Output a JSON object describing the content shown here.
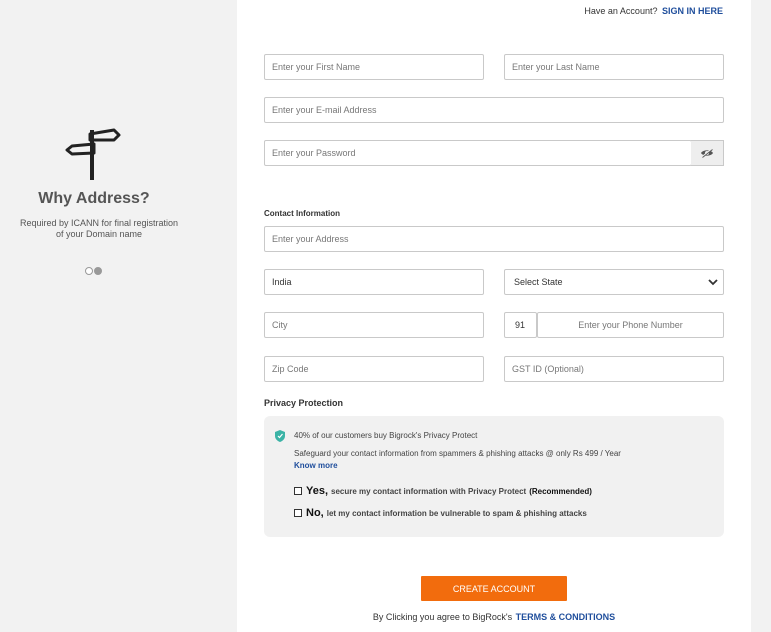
{
  "left_panel": {
    "title": "Why Address?",
    "description_line1": "Required by ICANN for final registration",
    "description_line2": "of your Domain name",
    "icon": "signpost-icon"
  },
  "header": {
    "have_account": "Have an Account?",
    "sign_in": "SIGN IN HERE"
  },
  "form": {
    "first_name_placeholder": "Enter your First Name",
    "last_name_placeholder": "Enter your Last Name",
    "email_placeholder": "Enter your E-mail Address",
    "password_placeholder": "Enter your Password",
    "contact_label": "Contact Information",
    "address_placeholder": "Enter your Address",
    "country_value": "India",
    "state_value": "Select State",
    "city_placeholder": "City",
    "phone_code": "91",
    "phone_placeholder": "Enter your Phone Number",
    "zip_placeholder": "Zip Code",
    "gst_placeholder": "GST ID (Optional)"
  },
  "privacy": {
    "title": "Privacy Protection",
    "stat": "40% of our customers buy Bigrock's Privacy Protect",
    "description": "Safeguard your contact information from spammers & phishing attacks @ only Rs 499 / Year",
    "know_more": "Know more",
    "yes_word": "Yes,",
    "yes_text": "secure my contact information with Privacy Protect",
    "yes_recommended": "(Recommended)",
    "no_word": "No,",
    "no_text": "let my contact information be vulnerable to spam & phishing attacks"
  },
  "footer": {
    "create_button": "CREATE ACCOUNT",
    "terms_prefix": "By Clicking you agree to BigRock's",
    "terms_link": "TERMS & CONDITIONS"
  },
  "colors": {
    "accent_orange": "#f26c0d",
    "link_blue": "#1f4e9c",
    "shield_teal": "#3bb3a6"
  }
}
